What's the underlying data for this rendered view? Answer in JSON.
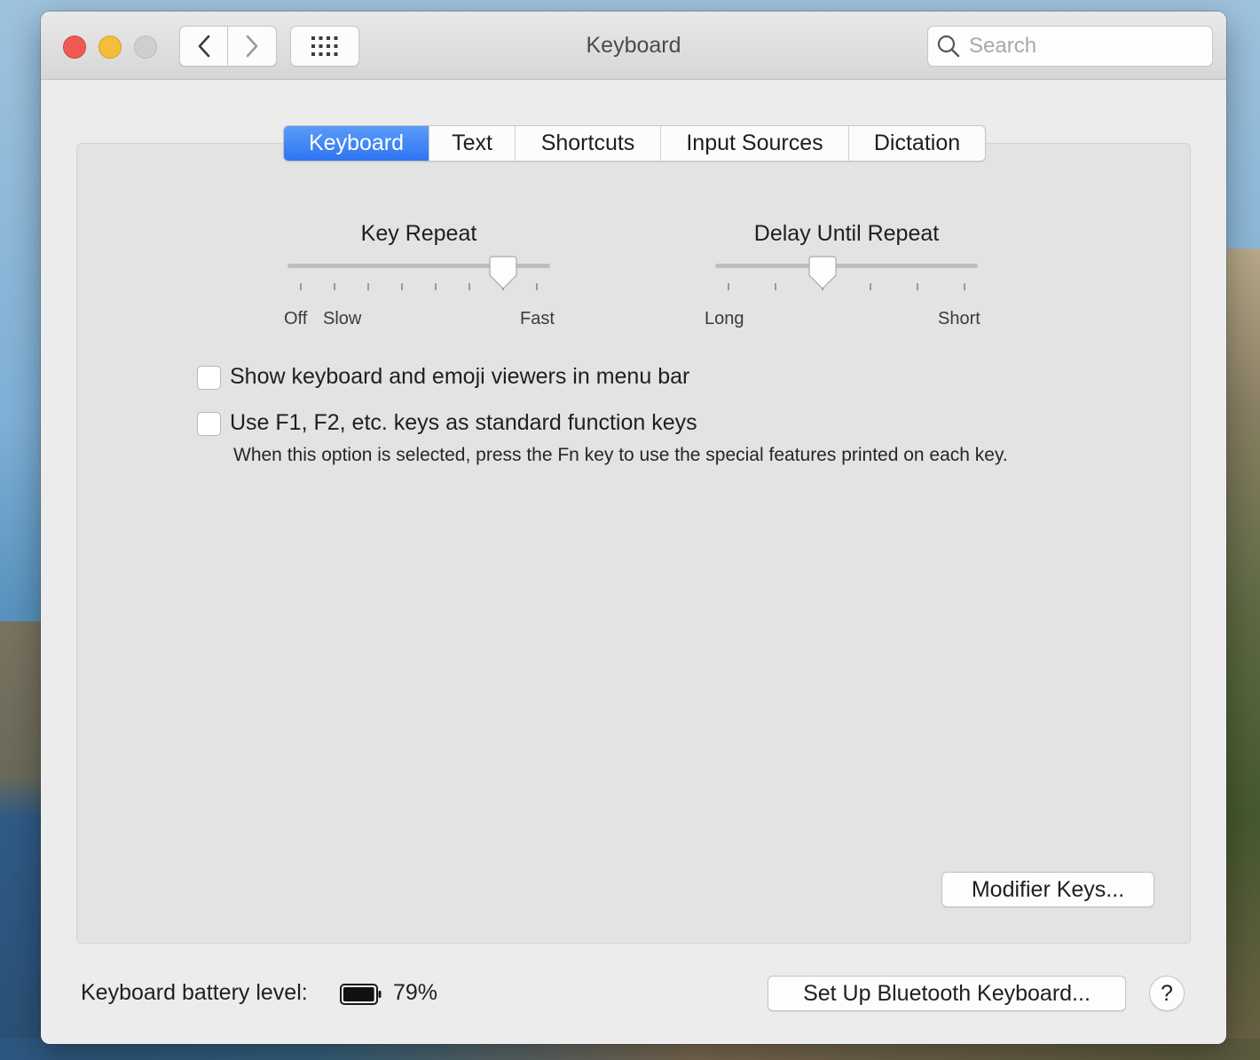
{
  "window": {
    "title": "Keyboard"
  },
  "toolbar": {
    "back_icon": "chevron-left-icon",
    "forward_icon": "chevron-right-icon",
    "grid_icon": "grid-icon"
  },
  "search": {
    "placeholder": "Search",
    "value": ""
  },
  "tabs": [
    {
      "label": "Keyboard",
      "active": true
    },
    {
      "label": "Text",
      "active": false
    },
    {
      "label": "Shortcuts",
      "active": false
    },
    {
      "label": "Input Sources",
      "active": false
    },
    {
      "label": "Dictation",
      "active": false
    }
  ],
  "key_repeat": {
    "title": "Key Repeat",
    "labels": {
      "off": "Off",
      "slow": "Slow",
      "fast": "Fast"
    },
    "tick_count": 8,
    "selected_tick": 7
  },
  "delay_until_repeat": {
    "title": "Delay Until Repeat",
    "labels": {
      "long": "Long",
      "short": "Short"
    },
    "tick_count": 6,
    "selected_tick": 3
  },
  "options": {
    "show_viewers": {
      "label": "Show keyboard and emoji viewers in menu bar",
      "checked": false
    },
    "function_keys": {
      "label": "Use F1, F2, etc. keys as standard function keys",
      "checked": false
    },
    "function_keys_note": "When this option is selected, press the Fn key to use the special features printed on each key."
  },
  "buttons": {
    "modifier_keys": "Modifier Keys...",
    "bluetooth_setup": "Set Up Bluetooth Keyboard...",
    "help": "?"
  },
  "battery": {
    "label": "Keyboard battery level:",
    "percent": "79%",
    "level": 0.79
  },
  "colors": {
    "accent": "#2f74f2",
    "close": "#ee5b55",
    "minimize": "#f5bd3a",
    "zoom_disabled": "#cfcfcf"
  }
}
